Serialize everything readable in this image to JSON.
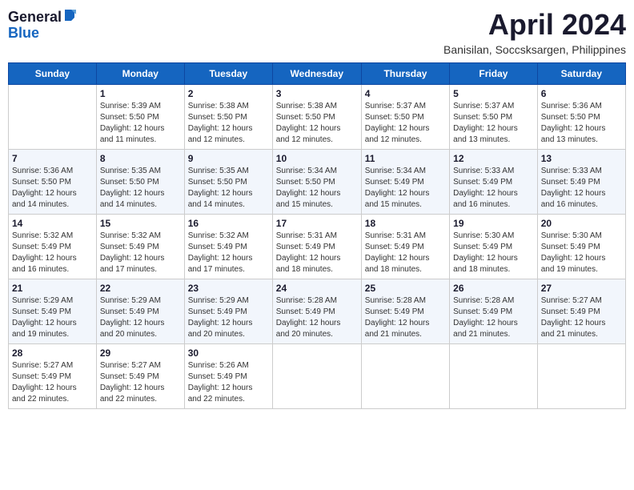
{
  "header": {
    "logo_general": "General",
    "logo_blue": "Blue",
    "month": "April 2024",
    "location": "Banisilan, Soccsksargen, Philippines"
  },
  "weekdays": [
    "Sunday",
    "Monday",
    "Tuesday",
    "Wednesday",
    "Thursday",
    "Friday",
    "Saturday"
  ],
  "weeks": [
    [
      {
        "day": "",
        "info": ""
      },
      {
        "day": "1",
        "info": "Sunrise: 5:39 AM\nSunset: 5:50 PM\nDaylight: 12 hours\nand 11 minutes."
      },
      {
        "day": "2",
        "info": "Sunrise: 5:38 AM\nSunset: 5:50 PM\nDaylight: 12 hours\nand 12 minutes."
      },
      {
        "day": "3",
        "info": "Sunrise: 5:38 AM\nSunset: 5:50 PM\nDaylight: 12 hours\nand 12 minutes."
      },
      {
        "day": "4",
        "info": "Sunrise: 5:37 AM\nSunset: 5:50 PM\nDaylight: 12 hours\nand 12 minutes."
      },
      {
        "day": "5",
        "info": "Sunrise: 5:37 AM\nSunset: 5:50 PM\nDaylight: 12 hours\nand 13 minutes."
      },
      {
        "day": "6",
        "info": "Sunrise: 5:36 AM\nSunset: 5:50 PM\nDaylight: 12 hours\nand 13 minutes."
      }
    ],
    [
      {
        "day": "7",
        "info": "Sunrise: 5:36 AM\nSunset: 5:50 PM\nDaylight: 12 hours\nand 14 minutes."
      },
      {
        "day": "8",
        "info": "Sunrise: 5:35 AM\nSunset: 5:50 PM\nDaylight: 12 hours\nand 14 minutes."
      },
      {
        "day": "9",
        "info": "Sunrise: 5:35 AM\nSunset: 5:50 PM\nDaylight: 12 hours\nand 14 minutes."
      },
      {
        "day": "10",
        "info": "Sunrise: 5:34 AM\nSunset: 5:50 PM\nDaylight: 12 hours\nand 15 minutes."
      },
      {
        "day": "11",
        "info": "Sunrise: 5:34 AM\nSunset: 5:49 PM\nDaylight: 12 hours\nand 15 minutes."
      },
      {
        "day": "12",
        "info": "Sunrise: 5:33 AM\nSunset: 5:49 PM\nDaylight: 12 hours\nand 16 minutes."
      },
      {
        "day": "13",
        "info": "Sunrise: 5:33 AM\nSunset: 5:49 PM\nDaylight: 12 hours\nand 16 minutes."
      }
    ],
    [
      {
        "day": "14",
        "info": "Sunrise: 5:32 AM\nSunset: 5:49 PM\nDaylight: 12 hours\nand 16 minutes."
      },
      {
        "day": "15",
        "info": "Sunrise: 5:32 AM\nSunset: 5:49 PM\nDaylight: 12 hours\nand 17 minutes."
      },
      {
        "day": "16",
        "info": "Sunrise: 5:32 AM\nSunset: 5:49 PM\nDaylight: 12 hours\nand 17 minutes."
      },
      {
        "day": "17",
        "info": "Sunrise: 5:31 AM\nSunset: 5:49 PM\nDaylight: 12 hours\nand 18 minutes."
      },
      {
        "day": "18",
        "info": "Sunrise: 5:31 AM\nSunset: 5:49 PM\nDaylight: 12 hours\nand 18 minutes."
      },
      {
        "day": "19",
        "info": "Sunrise: 5:30 AM\nSunset: 5:49 PM\nDaylight: 12 hours\nand 18 minutes."
      },
      {
        "day": "20",
        "info": "Sunrise: 5:30 AM\nSunset: 5:49 PM\nDaylight: 12 hours\nand 19 minutes."
      }
    ],
    [
      {
        "day": "21",
        "info": "Sunrise: 5:29 AM\nSunset: 5:49 PM\nDaylight: 12 hours\nand 19 minutes."
      },
      {
        "day": "22",
        "info": "Sunrise: 5:29 AM\nSunset: 5:49 PM\nDaylight: 12 hours\nand 20 minutes."
      },
      {
        "day": "23",
        "info": "Sunrise: 5:29 AM\nSunset: 5:49 PM\nDaylight: 12 hours\nand 20 minutes."
      },
      {
        "day": "24",
        "info": "Sunrise: 5:28 AM\nSunset: 5:49 PM\nDaylight: 12 hours\nand 20 minutes."
      },
      {
        "day": "25",
        "info": "Sunrise: 5:28 AM\nSunset: 5:49 PM\nDaylight: 12 hours\nand 21 minutes."
      },
      {
        "day": "26",
        "info": "Sunrise: 5:28 AM\nSunset: 5:49 PM\nDaylight: 12 hours\nand 21 minutes."
      },
      {
        "day": "27",
        "info": "Sunrise: 5:27 AM\nSunset: 5:49 PM\nDaylight: 12 hours\nand 21 minutes."
      }
    ],
    [
      {
        "day": "28",
        "info": "Sunrise: 5:27 AM\nSunset: 5:49 PM\nDaylight: 12 hours\nand 22 minutes."
      },
      {
        "day": "29",
        "info": "Sunrise: 5:27 AM\nSunset: 5:49 PM\nDaylight: 12 hours\nand 22 minutes."
      },
      {
        "day": "30",
        "info": "Sunrise: 5:26 AM\nSunset: 5:49 PM\nDaylight: 12 hours\nand 22 minutes."
      },
      {
        "day": "",
        "info": ""
      },
      {
        "day": "",
        "info": ""
      },
      {
        "day": "",
        "info": ""
      },
      {
        "day": "",
        "info": ""
      }
    ]
  ]
}
